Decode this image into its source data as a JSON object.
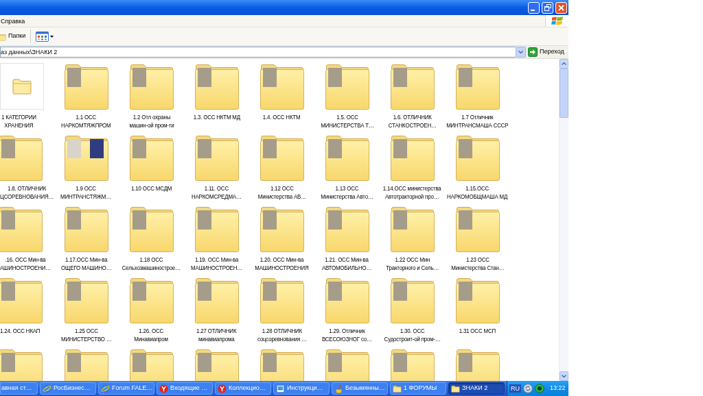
{
  "window": {
    "menu": [
      {
        "label": "Справка"
      }
    ],
    "toolbar": {
      "folders_button": "Папки"
    },
    "address_bar": {
      "path": "аз данных\\ЗНАКИ 2",
      "go_button": "Переход"
    }
  },
  "folders": [
    {
      "kind": "category",
      "label": [
        "1 КАТЕГОРИИ",
        "ХРАНЕНИЯ"
      ]
    },
    {
      "kind": "photo",
      "label": [
        "1.1 ОСС",
        "НАРКОМТЯЖПРОМ"
      ]
    },
    {
      "kind": "photo",
      "label": [
        "1.2 Отл охраны",
        "машин-ой пром-ти"
      ]
    },
    {
      "kind": "photo",
      "label": [
        "1.3. ОСС НКТМ МД"
      ]
    },
    {
      "kind": "photo",
      "label": [
        "1.4. ОСС НКТМ"
      ]
    },
    {
      "kind": "photo",
      "label": [
        "1.5. ОСС",
        "МИНИСТЕРСТВА Т…"
      ]
    },
    {
      "kind": "photo",
      "label": [
        "1.6. ОТЛИЧНИК",
        "СТАНКОСТРОЕН…"
      ]
    },
    {
      "kind": "photo",
      "label": [
        "1.7 Отличник",
        "МИНТРАНСМАША СССР"
      ]
    },
    {
      "kind": "photo",
      "label": [
        "1.8. ОТЛИЧНИК",
        "ЦСОРЕВНОВАНИЯ…"
      ]
    },
    {
      "kind": "two-photos",
      "label": [
        "1.9 ОСС",
        "МИНТРАНСТЯЖМ…"
      ]
    },
    {
      "kind": "photo",
      "label": [
        "1.10 ОСС МСДМ"
      ]
    },
    {
      "kind": "photo",
      "label": [
        "1.11. ОСС",
        "НАРКОМСРЕДМА…"
      ]
    },
    {
      "kind": "photo",
      "label": [
        "1.12 ОСС",
        "Министерства АВ…"
      ]
    },
    {
      "kind": "photo",
      "label": [
        "1.13 ОСС",
        "Министерства Авто…"
      ]
    },
    {
      "kind": "photo",
      "label": [
        "1.14.ОСС министерства",
        "Автотракторной про…"
      ]
    },
    {
      "kind": "photo",
      "label": [
        "1.15.ОСС",
        "НАРКОМОБЩМАША МД"
      ]
    },
    {
      "kind": "photo",
      "label": [
        ".16. ОСС Мин-ва",
        "АШИНОСТРОЕНИ…"
      ]
    },
    {
      "kind": "photo",
      "label": [
        "1.17.ОСС Мин-ва",
        "ОЩЕГО МАШИНО…"
      ]
    },
    {
      "kind": "photo",
      "label": [
        "1.18 ОСС",
        "Сельхозмашинострое…"
      ]
    },
    {
      "kind": "photo",
      "label": [
        "1.19. ОСС Мин-ва",
        "МАШИНОСТРОЕН…"
      ]
    },
    {
      "kind": "photo",
      "label": [
        "1.20. ОСС Мин-ва",
        "МАШИНОСТРОЕНИЯ"
      ]
    },
    {
      "kind": "photo",
      "label": [
        "1.21. ОСС Мин-ва",
        "АВТОМОБИЛЬНО…"
      ]
    },
    {
      "kind": "photo",
      "label": [
        "1.22 ОСС Мин",
        "Тракторного и Сель…"
      ]
    },
    {
      "kind": "photo",
      "label": [
        "1.23 ОСС",
        "Министерства Стан…"
      ]
    },
    {
      "kind": "photo",
      "label": [
        "1.24. ОСС НКАП"
      ]
    },
    {
      "kind": "photo",
      "label": [
        "1.25 ОСС",
        "МИНИСТЕРСТВО …"
      ]
    },
    {
      "kind": "photo",
      "label": [
        "1.26. ОСС",
        "Минавиапром"
      ]
    },
    {
      "kind": "photo",
      "label": [
        "1.27 ОТЛИЧНИК",
        "минавиапрома"
      ]
    },
    {
      "kind": "photo",
      "label": [
        "1.28 ОТЛИЧНИК",
        "соцсоревнования …"
      ]
    },
    {
      "kind": "photo",
      "label": [
        "1.29. Отличник",
        "ВСЕСОЮЗНОГ со…"
      ]
    },
    {
      "kind": "photo",
      "label": [
        "1.30. ОСС",
        "Судостроит-ой пром-…"
      ]
    },
    {
      "kind": "photo",
      "label": [
        "1.31 ОСС МСП"
      ]
    },
    {
      "kind": "photo"
    },
    {
      "kind": "photo"
    },
    {
      "kind": "photo"
    },
    {
      "kind": "photo"
    },
    {
      "kind": "photo"
    },
    {
      "kind": "photo"
    },
    {
      "kind": "photo"
    },
    {
      "kind": "photo"
    }
  ],
  "taskbar": {
    "buttons": [
      {
        "kind": "plain",
        "label": "авная ст…",
        "selected": false
      },
      {
        "kind": "browser",
        "label": "РосБизнес…",
        "selected": false
      },
      {
        "kind": "browser",
        "label": "Forum FALE…",
        "selected": false
      },
      {
        "kind": "yandex",
        "label": "Входящие …",
        "selected": false
      },
      {
        "kind": "yandex",
        "label": "Коллекцио…",
        "selected": false
      },
      {
        "kind": "picture",
        "label": "Инструкци…",
        "selected": false
      },
      {
        "kind": "paint",
        "label": "Безымянны…",
        "selected": false
      },
      {
        "kind": "folder",
        "label": "1 ФОРУМЫ",
        "selected": false
      },
      {
        "kind": "folder",
        "label": "ЗНАКИ 2",
        "selected": true
      }
    ],
    "language": "RU",
    "clock": "13:22"
  }
}
